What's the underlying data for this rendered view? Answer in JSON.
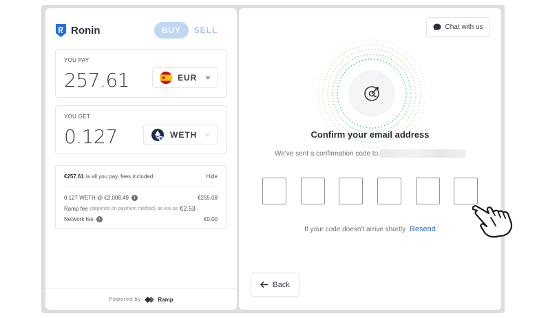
{
  "brand": {
    "name": "Ronin",
    "logo_icon": "ronin-shield-icon",
    "accent": "#1f6fe0"
  },
  "toggle": {
    "buy": "BUY",
    "sell": "SELL",
    "active": "BUY"
  },
  "pay": {
    "label": "YOU PAY",
    "amount": "257.61",
    "currency": "EUR",
    "currency_icon": "spain-flag-icon"
  },
  "get": {
    "label": "YOU GET",
    "amount": "0.127",
    "currency": "WETH",
    "currency_icon": "weth-icon"
  },
  "fees": {
    "summary_amount": "€257.61",
    "summary_text": "is all you pay, fees included",
    "hide": "Hide",
    "rate_label": "0.127 WETH @ €2,008.49",
    "rate_value": "€255.08",
    "ramp_fee_label": "Ramp fee",
    "ramp_fee_note": "(depends on payment method)",
    "ramp_fee_prefix": "as low as",
    "ramp_fee_value": "€2.53",
    "network_fee_label": "Network fee",
    "network_fee_value": "€0.00"
  },
  "footer": {
    "powered_by": "Powered by",
    "provider": "Ramp"
  },
  "verify": {
    "chat": "Chat with us",
    "title": "Confirm your email address",
    "sent_text": "We've sent a confirmation code to",
    "code_length": 6,
    "resend_prompt": "If your code doesn't arrive shortly",
    "resend_link": "Resend",
    "back": "Back"
  }
}
